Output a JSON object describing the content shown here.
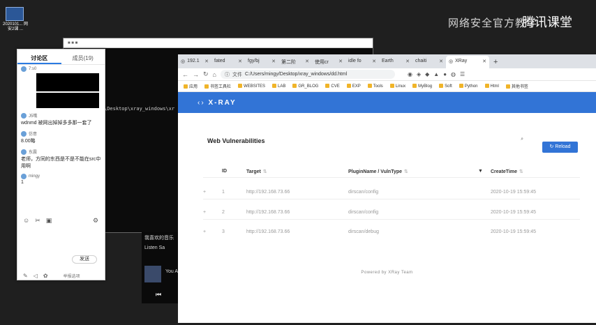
{
  "desktop": {
    "icon_label": "2020101...\n网安2课 ...",
    "watermark": "网络安全官方教学",
    "watermark_sub": "腾讯课堂"
  },
  "terminal": {
    "title": "",
    "path_text": "\\Desktop\\xray_windows\\xr"
  },
  "player": {
    "line1": "我喜欢的音乐",
    "line2": "Listen Sa",
    "line3": "You Are",
    "prev": "⏮"
  },
  "chat": {
    "tab_discussion": "讨论区",
    "tab_members": "成员(19)",
    "messages": [
      {
        "user": "7:s0",
        "text": ""
      },
      {
        "user": "J5哦",
        "text": "wdnmd 被网出掉掉多多那一套了"
      },
      {
        "user": "仿意",
        "text": "8.00略"
      },
      {
        "user": "东震",
        "text": "老师，方同的东西是不是不能在src中用啊"
      },
      {
        "user": "mingy",
        "text": "1"
      }
    ],
    "send_label": "发送",
    "bottom_text": "举报选项"
  },
  "browser": {
    "tabs": [
      {
        "label": "192.1"
      },
      {
        "label": "fated"
      },
      {
        "label": "fgy/bj"
      },
      {
        "label": "第二阶"
      },
      {
        "label": "使用cr"
      },
      {
        "label": "idle fo"
      },
      {
        "label": "Earth"
      },
      {
        "label": "chaiti"
      },
      {
        "label": "XRay"
      }
    ],
    "address_prefix": "文件",
    "address": "C:/Users/mingy/Desktop/xray_windows/dd.html",
    "bookmarks": [
      "应用",
      "书签工具栏",
      "WEBSITES",
      "LAB",
      "GR_BLOG",
      "CVE",
      "EXP",
      "Tools",
      "Linux",
      "MyBlog",
      "Soft",
      "Python",
      "Html"
    ],
    "other_bookmarks": "其他书签"
  },
  "xray": {
    "logo": "X-RAY",
    "heading": "Web Vulnerabilities",
    "search_placeholder": "",
    "reload_label": "Reload",
    "columns": {
      "id": "ID",
      "target": "Target",
      "plugin": "PluginName / VulnType",
      "time": "CreateTime"
    },
    "rows": [
      {
        "id": "1",
        "target": "http://192.168.73.66",
        "plugin": "dirscan/config",
        "time": "2020-10-19 15:59:45"
      },
      {
        "id": "2",
        "target": "http://192.168.73.66",
        "plugin": "dirscan/config",
        "time": "2020-10-19 15:59:45"
      },
      {
        "id": "3",
        "target": "http://192.168.73.66",
        "plugin": "dirscan/debug",
        "time": "2020-10-19 15:59:45"
      }
    ],
    "footer": "Powered by XRay Team"
  }
}
